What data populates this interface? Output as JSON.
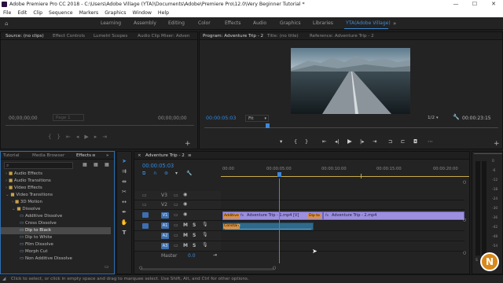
{
  "window": {
    "title": "Adobe Premiere Pro CC 2018 - C:\\Users\\Adobe Village (YTA)\\Documents\\Adobe\\Premiere Pro\\12.0\\Very Beginner Tutorial *",
    "minimize": "—",
    "maximize": "☐",
    "close": "✕"
  },
  "menu": [
    "File",
    "Edit",
    "Clip",
    "Sequence",
    "Markers",
    "Graphics",
    "Window",
    "Help"
  ],
  "workspaces": {
    "items": [
      "Learning",
      "Assembly",
      "Editing",
      "Color",
      "Effects",
      "Audio",
      "Graphics",
      "Libraries",
      "YTA(Adobe Village)"
    ],
    "active_index": 8
  },
  "source_panel": {
    "tabs": [
      "Source: (no clips)",
      "Effect Controls",
      "Lumetri Scopes",
      "Audio Clip Mixer: Adven"
    ],
    "timecode_left": "00;00;00;00",
    "page": "Page 1",
    "timecode_right": "00;00;00;00"
  },
  "program_panel": {
    "tabs": [
      "Program: Adventure Trip - 2",
      "Title: (no title)",
      "Reference: Adventure Trip - 2"
    ],
    "timecode": "00:00:05:03",
    "fit": "Fit",
    "quality": "1/2",
    "duration": "00:00:23:15"
  },
  "effects_panel": {
    "tabs": [
      "Tutorial",
      "Media Browser",
      "Effects"
    ],
    "items": [
      {
        "label": "Audio Effects",
        "type": "folder",
        "level": 1,
        "open": false
      },
      {
        "label": "Audio Transitions",
        "type": "folder",
        "level": 1,
        "open": false
      },
      {
        "label": "Video Effects",
        "type": "folder",
        "level": 1,
        "open": false
      },
      {
        "label": "Video Transitions",
        "type": "folder",
        "level": 1,
        "open": true
      },
      {
        "label": "3D Motion",
        "type": "folder",
        "level": 2,
        "open": false
      },
      {
        "label": "Dissolve",
        "type": "folder",
        "level": 2,
        "open": true
      },
      {
        "label": "Additive Dissolve",
        "type": "effect",
        "level": 3
      },
      {
        "label": "Cross Dissolve",
        "type": "effect",
        "level": 3
      },
      {
        "label": "Dip to Black",
        "type": "effect",
        "level": 3,
        "selected": true
      },
      {
        "label": "Dip to White",
        "type": "effect",
        "level": 3
      },
      {
        "label": "Film Dissolve",
        "type": "effect",
        "level": 3
      },
      {
        "label": "Morph Cut",
        "type": "effect",
        "level": 3
      },
      {
        "label": "Non Additive Dissolve",
        "type": "effect",
        "level": 3
      }
    ]
  },
  "timeline": {
    "tab": "Adventure Trip - 2",
    "timecode": "00:00:05:03",
    "ruler": [
      "00:00",
      "00:00:05:00",
      "00:00:10:00",
      "00:00:15:00",
      "00:00:20:00"
    ],
    "tracks": [
      {
        "id": "V3",
        "kind": "video"
      },
      {
        "id": "V2",
        "kind": "video"
      },
      {
        "id": "V1",
        "kind": "video"
      },
      {
        "id": "A1",
        "kind": "audio"
      },
      {
        "id": "A2",
        "kind": "audio"
      },
      {
        "id": "A3",
        "kind": "audio"
      }
    ],
    "master_label": "Master",
    "master_value": "0.0",
    "clips": {
      "v1_label_a": "Additive",
      "v1_clip_1": "Adventure Trip - 1.mp4 [V]",
      "v1_label_b": "Dip to",
      "v1_clip_2": "Adventure Trip - 2.mp4",
      "a1_label": "Constan"
    }
  },
  "meter": {
    "scale": [
      "0",
      "-6",
      "-12",
      "-18",
      "-24",
      "-30",
      "-36",
      "-42",
      "-48",
      "-54"
    ],
    "footer": [
      "S",
      "S"
    ]
  },
  "status": "Click to select, or click in empty space and drag to marquee select. Use Shift, Alt, and Ctrl for other options.",
  "colors": {
    "accent": "#2d8ceb",
    "video_clip": "#9b8fde",
    "audio_clip": "#2f6a8c",
    "transition": "#dc8f3e",
    "playhead": "#3f86d6"
  }
}
